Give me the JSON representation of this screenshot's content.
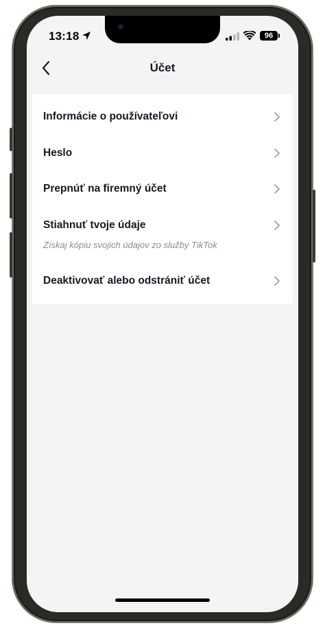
{
  "status_bar": {
    "time": "13:18",
    "battery": "96",
    "icons": [
      "location-arrow-icon",
      "cellular-signal-icon",
      "wifi-icon",
      "battery-icon"
    ]
  },
  "header": {
    "title": "Účet",
    "back_icon": "chevron-left-icon"
  },
  "menu": {
    "items": [
      {
        "label": "Informácie o používateľovi",
        "icon": "chevron-right-icon"
      },
      {
        "label": "Heslo",
        "icon": "chevron-right-icon"
      },
      {
        "label": "Prepnúť na firemný účet",
        "icon": "chevron-right-icon"
      },
      {
        "label": "Stiahnuť tvoje údaje",
        "subtitle": "Získaj kópiu svojich údajov zo služby TikTok",
        "icon": "chevron-right-icon"
      },
      {
        "label": "Deaktivovať alebo odstrániť účet",
        "icon": "chevron-right-icon"
      }
    ]
  },
  "colors": {
    "background": "#f4f4f4",
    "card": "#ffffff",
    "text_primary": "#161823",
    "text_secondary": "#8a8b91",
    "chevron": "#9b9ca0"
  }
}
